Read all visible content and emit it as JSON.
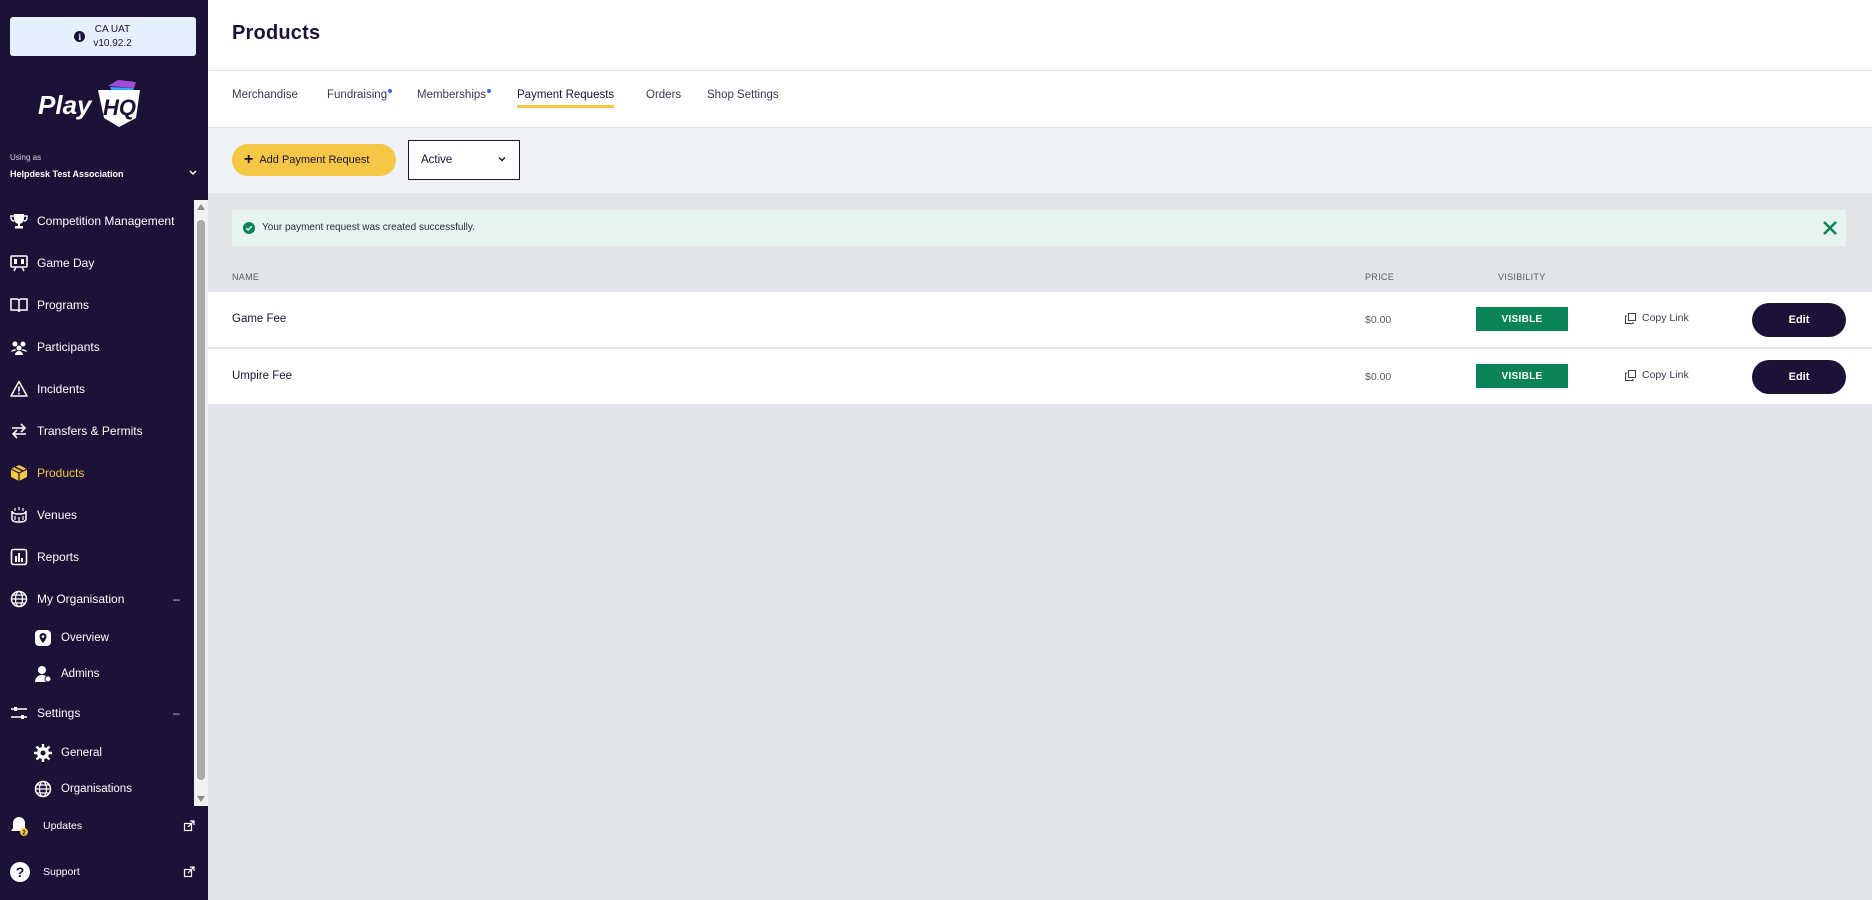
{
  "environment": {
    "name": "CA UAT",
    "version": "v10.92.2",
    "icon": "info-icon"
  },
  "logo": {
    "text_play": "Play",
    "text_hq": "HQ"
  },
  "user_context": {
    "using_as": "Using as",
    "org": "Helpdesk Test Association"
  },
  "sidebar": {
    "items": [
      {
        "label": "Competition Management",
        "icon": "trophy-icon"
      },
      {
        "label": "Game Day",
        "icon": "scoreboard-icon"
      },
      {
        "label": "Programs",
        "icon": "book-icon"
      },
      {
        "label": "Participants",
        "icon": "people-icon"
      },
      {
        "label": "Incidents",
        "icon": "warning-icon"
      },
      {
        "label": "Transfers & Permits",
        "icon": "transfer-arrows-icon"
      },
      {
        "label": "Products",
        "icon": "box-icon",
        "active": true
      },
      {
        "label": "Venues",
        "icon": "stadium-icon"
      },
      {
        "label": "Reports",
        "icon": "report-icon"
      },
      {
        "label": "My Organisation",
        "icon": "globe-icon",
        "collapse": "–"
      },
      {
        "label": "Overview",
        "icon": "location-pin-icon"
      },
      {
        "label": "Admins",
        "icon": "admin-user-icon"
      },
      {
        "label": "Settings",
        "icon": "sliders-icon",
        "collapse": "–"
      },
      {
        "label": "General",
        "icon": "gear-icon"
      },
      {
        "label": "Organisations",
        "icon": "globe-icon"
      }
    ],
    "bottom": [
      {
        "label": "Updates",
        "icon": "bell-icon",
        "badge": "2"
      },
      {
        "label": "Support",
        "icon": "help-icon"
      }
    ]
  },
  "header": {
    "title": "Products"
  },
  "tabs": [
    {
      "label": "Merchandise"
    },
    {
      "label": "Fundraising",
      "dot": true
    },
    {
      "label": "Memberships",
      "dot": true
    },
    {
      "label": "Payment Requests",
      "active": true
    },
    {
      "label": "Orders"
    },
    {
      "label": "Shop Settings"
    }
  ],
  "toolbar": {
    "add_label": "Add Payment Request",
    "status_value": "Active"
  },
  "alert": {
    "message": "Your payment request was created successfully."
  },
  "table": {
    "columns": {
      "name": "NAME",
      "price": "PRICE",
      "visibility": "VISIBILITY"
    },
    "rows": [
      {
        "name": "Game Fee",
        "price": "$0.00",
        "visibility": "VISIBLE",
        "copy": "Copy Link",
        "edit": "Edit"
      },
      {
        "name": "Umpire Fee",
        "price": "$0.00",
        "visibility": "VISIBLE",
        "copy": "Copy Link",
        "edit": "Edit"
      }
    ]
  },
  "colors": {
    "sidebar_bg": "#1c1137",
    "accent": "#f5c744",
    "visible": "#0a8457",
    "link_dot": "#2e6be6"
  }
}
